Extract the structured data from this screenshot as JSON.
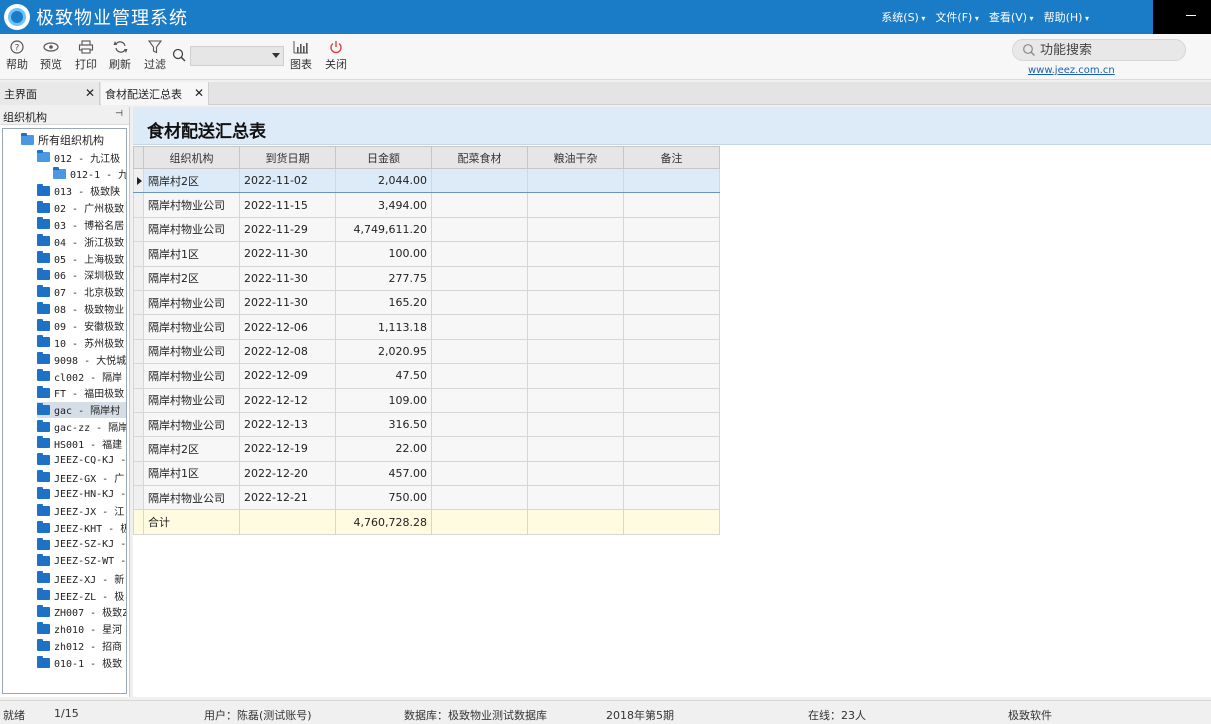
{
  "app": {
    "title": "极致物业管理系统"
  },
  "menu": [
    {
      "label": "系统(S)"
    },
    {
      "label": "文件(F)"
    },
    {
      "label": "查看(V)"
    },
    {
      "label": "帮助(H)"
    }
  ],
  "toolbar": {
    "help": "帮助",
    "preview": "预览",
    "print": "打印",
    "refresh": "刷新",
    "filter": "过滤",
    "chart": "图表",
    "close": "关闭",
    "search_value": "",
    "func_search_placeholder": "功能搜索",
    "site_link": "www.jeez.com.cn"
  },
  "tabs": [
    {
      "label": "主界面"
    },
    {
      "label": "食材配送汇总表"
    }
  ],
  "sidebar": {
    "header": "组织机构",
    "root": "所有组织机构",
    "items": [
      {
        "label": "012 - 九江极"
      },
      {
        "label": "012-1 - 九"
      },
      {
        "label": "013 - 极致陕"
      },
      {
        "label": "02 - 广州极致"
      },
      {
        "label": "03 - 博裕名居"
      },
      {
        "label": "04 - 浙江极致"
      },
      {
        "label": "05 - 上海极致"
      },
      {
        "label": "06 - 深圳极致"
      },
      {
        "label": "07 - 北京极致"
      },
      {
        "label": "08 - 极致物业"
      },
      {
        "label": "09 - 安徽极致"
      },
      {
        "label": "10 - 苏州极致"
      },
      {
        "label": "9098 - 大悦城"
      },
      {
        "label": "cl002 - 隔岸"
      },
      {
        "label": "FT - 福田极致"
      },
      {
        "label": "gac - 隔岸村"
      },
      {
        "label": "gac-zz - 隔岸"
      },
      {
        "label": "HS001 - 福建"
      },
      {
        "label": "JEEZ-CQ-KJ -"
      },
      {
        "label": "JEEZ-GX - 广"
      },
      {
        "label": "JEEZ-HN-KJ -"
      },
      {
        "label": "JEEZ-JX - 江"
      },
      {
        "label": "JEEZ-KHT - 极"
      },
      {
        "label": "JEEZ-SZ-KJ -"
      },
      {
        "label": "JEEZ-SZ-WT -"
      },
      {
        "label": "JEEZ-XJ - 新"
      },
      {
        "label": "JEEZ-ZL - 极"
      },
      {
        "label": "ZH007 - 极致Z"
      },
      {
        "label": "zh010 - 星河"
      },
      {
        "label": "zh012 - 招商"
      },
      {
        "label": "010-1 - 极致"
      }
    ]
  },
  "report": {
    "title": "食材配送汇总表",
    "columns": [
      "组织机构",
      "到货日期",
      "日金额",
      "配菜食材",
      "粮油干杂",
      "备注"
    ],
    "rows": [
      {
        "org": "隔岸村2区",
        "date": "2022-11-02",
        "amount": "2,044.00",
        "veg": "",
        "grain": "",
        "note": ""
      },
      {
        "org": "隔岸村物业公司",
        "date": "2022-11-15",
        "amount": "3,494.00",
        "veg": "",
        "grain": "",
        "note": ""
      },
      {
        "org": "隔岸村物业公司",
        "date": "2022-11-29",
        "amount": "4,749,611.20",
        "veg": "",
        "grain": "",
        "note": ""
      },
      {
        "org": "隔岸村1区",
        "date": "2022-11-30",
        "amount": "100.00",
        "veg": "",
        "grain": "",
        "note": ""
      },
      {
        "org": "隔岸村2区",
        "date": "2022-11-30",
        "amount": "277.75",
        "veg": "",
        "grain": "",
        "note": ""
      },
      {
        "org": "隔岸村物业公司",
        "date": "2022-11-30",
        "amount": "165.20",
        "veg": "",
        "grain": "",
        "note": ""
      },
      {
        "org": "隔岸村物业公司",
        "date": "2022-12-06",
        "amount": "1,113.18",
        "veg": "",
        "grain": "",
        "note": ""
      },
      {
        "org": "隔岸村物业公司",
        "date": "2022-12-08",
        "amount": "2,020.95",
        "veg": "",
        "grain": "",
        "note": ""
      },
      {
        "org": "隔岸村物业公司",
        "date": "2022-12-09",
        "amount": "47.50",
        "veg": "",
        "grain": "",
        "note": ""
      },
      {
        "org": "隔岸村物业公司",
        "date": "2022-12-12",
        "amount": "109.00",
        "veg": "",
        "grain": "",
        "note": ""
      },
      {
        "org": "隔岸村物业公司",
        "date": "2022-12-13",
        "amount": "316.50",
        "veg": "",
        "grain": "",
        "note": ""
      },
      {
        "org": "隔岸村2区",
        "date": "2022-12-19",
        "amount": "22.00",
        "veg": "",
        "grain": "",
        "note": ""
      },
      {
        "org": "隔岸村1区",
        "date": "2022-12-20",
        "amount": "457.00",
        "veg": "",
        "grain": "",
        "note": ""
      },
      {
        "org": "隔岸村物业公司",
        "date": "2022-12-21",
        "amount": "750.00",
        "veg": "",
        "grain": "",
        "note": ""
      }
    ],
    "total": {
      "label": "合计",
      "amount": "4,760,728.28"
    }
  },
  "status": {
    "state": "就绪",
    "page": "1/15",
    "user": "用户：陈磊(测试账号)",
    "database": "数据库：极致物业测试数据库",
    "period": "2018年第5期",
    "online": "在线：23人",
    "vendor": "极致软件"
  },
  "colors": {
    "titlebar": "#1a7bc6",
    "header_band": "#ddeaf7",
    "total_row": "#fffbe0",
    "selected_row": "#ddebf8"
  },
  "icons": [
    "help-icon",
    "eye-icon",
    "printer-icon",
    "refresh-icon",
    "filter-icon",
    "search-icon",
    "chart-icon",
    "power-icon",
    "folder-icon"
  ]
}
